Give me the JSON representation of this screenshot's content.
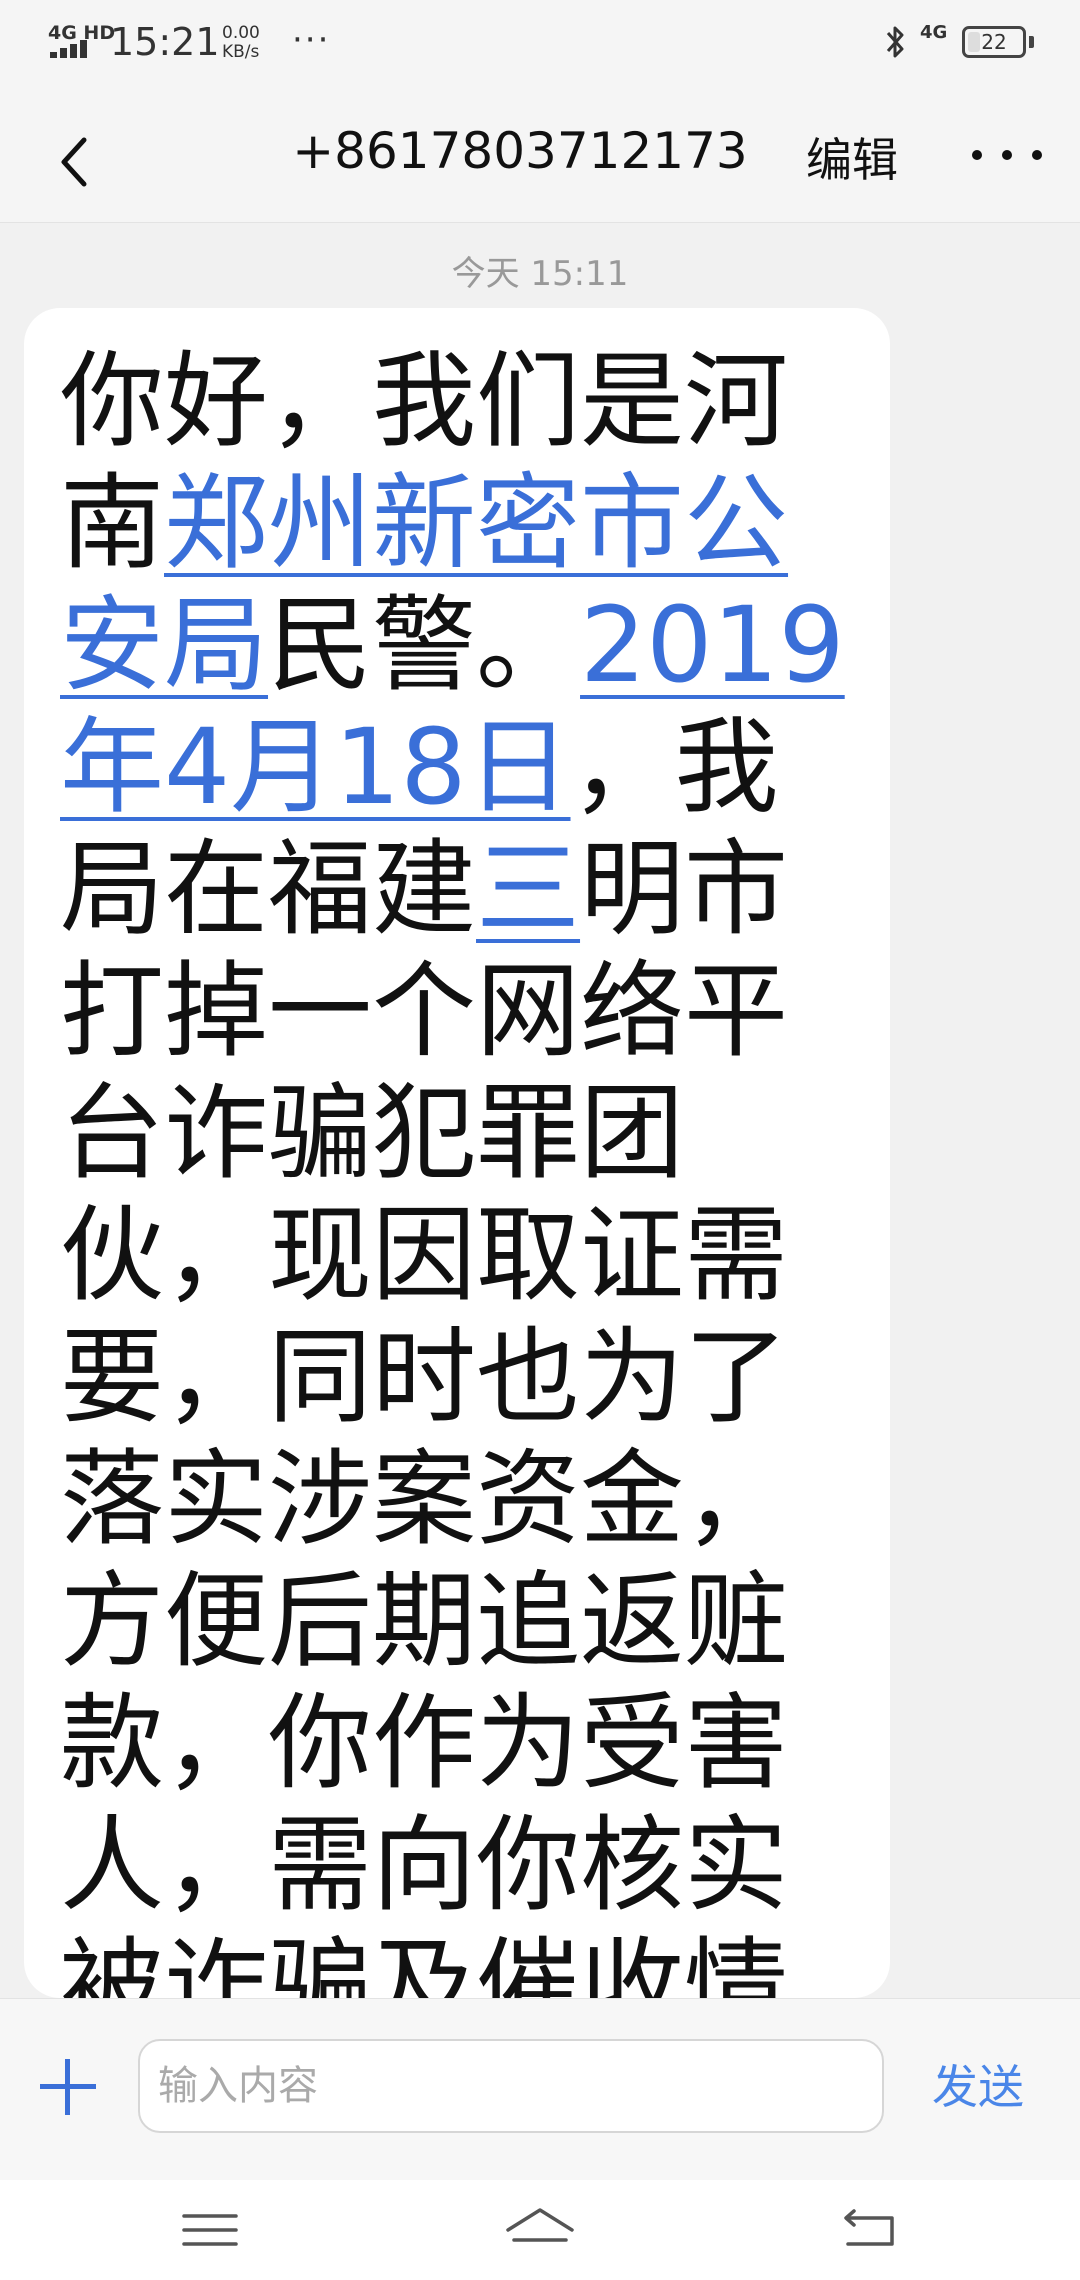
{
  "status_bar": {
    "network": "4G HD",
    "time": "15:21",
    "speed_value": "0.00",
    "speed_unit": "KB/s",
    "more": "···",
    "mobile": "4G",
    "battery": "22"
  },
  "header": {
    "back_icon": "chevron-left-icon",
    "title": "+8617803712173",
    "edit_label": "编辑",
    "more_icon": "more-dots-icon"
  },
  "conversation": {
    "timestamp": "今天 15:11",
    "message": {
      "text_1": "你好，我们是河南",
      "link_1": "郑州新密市公安局",
      "text_2": "民警。",
      "link_2": "2019年4月18日",
      "text_3": "，我局在福建",
      "link_3": "三",
      "text_4": "明市打掉一个网络平台诈骗犯罪团伙，现因取证需要，同时也为了落实涉案资金，方便后期追返赃款，你作为受害人，需向你核实被诈骗及催收情况，请你回电，若有异议，可"
    }
  },
  "input_bar": {
    "add_icon": "plus-icon",
    "placeholder": "输入内容",
    "value": "",
    "send_label": "发送"
  },
  "nav_bar": {
    "menu_icon": "menu-icon",
    "home_icon": "home-icon",
    "back_icon": "back-arrow-icon"
  },
  "colors": {
    "accent": "#3a6fd8",
    "send": "#4a86e8",
    "background": "#f1f1f1",
    "bubble": "#ffffff"
  }
}
